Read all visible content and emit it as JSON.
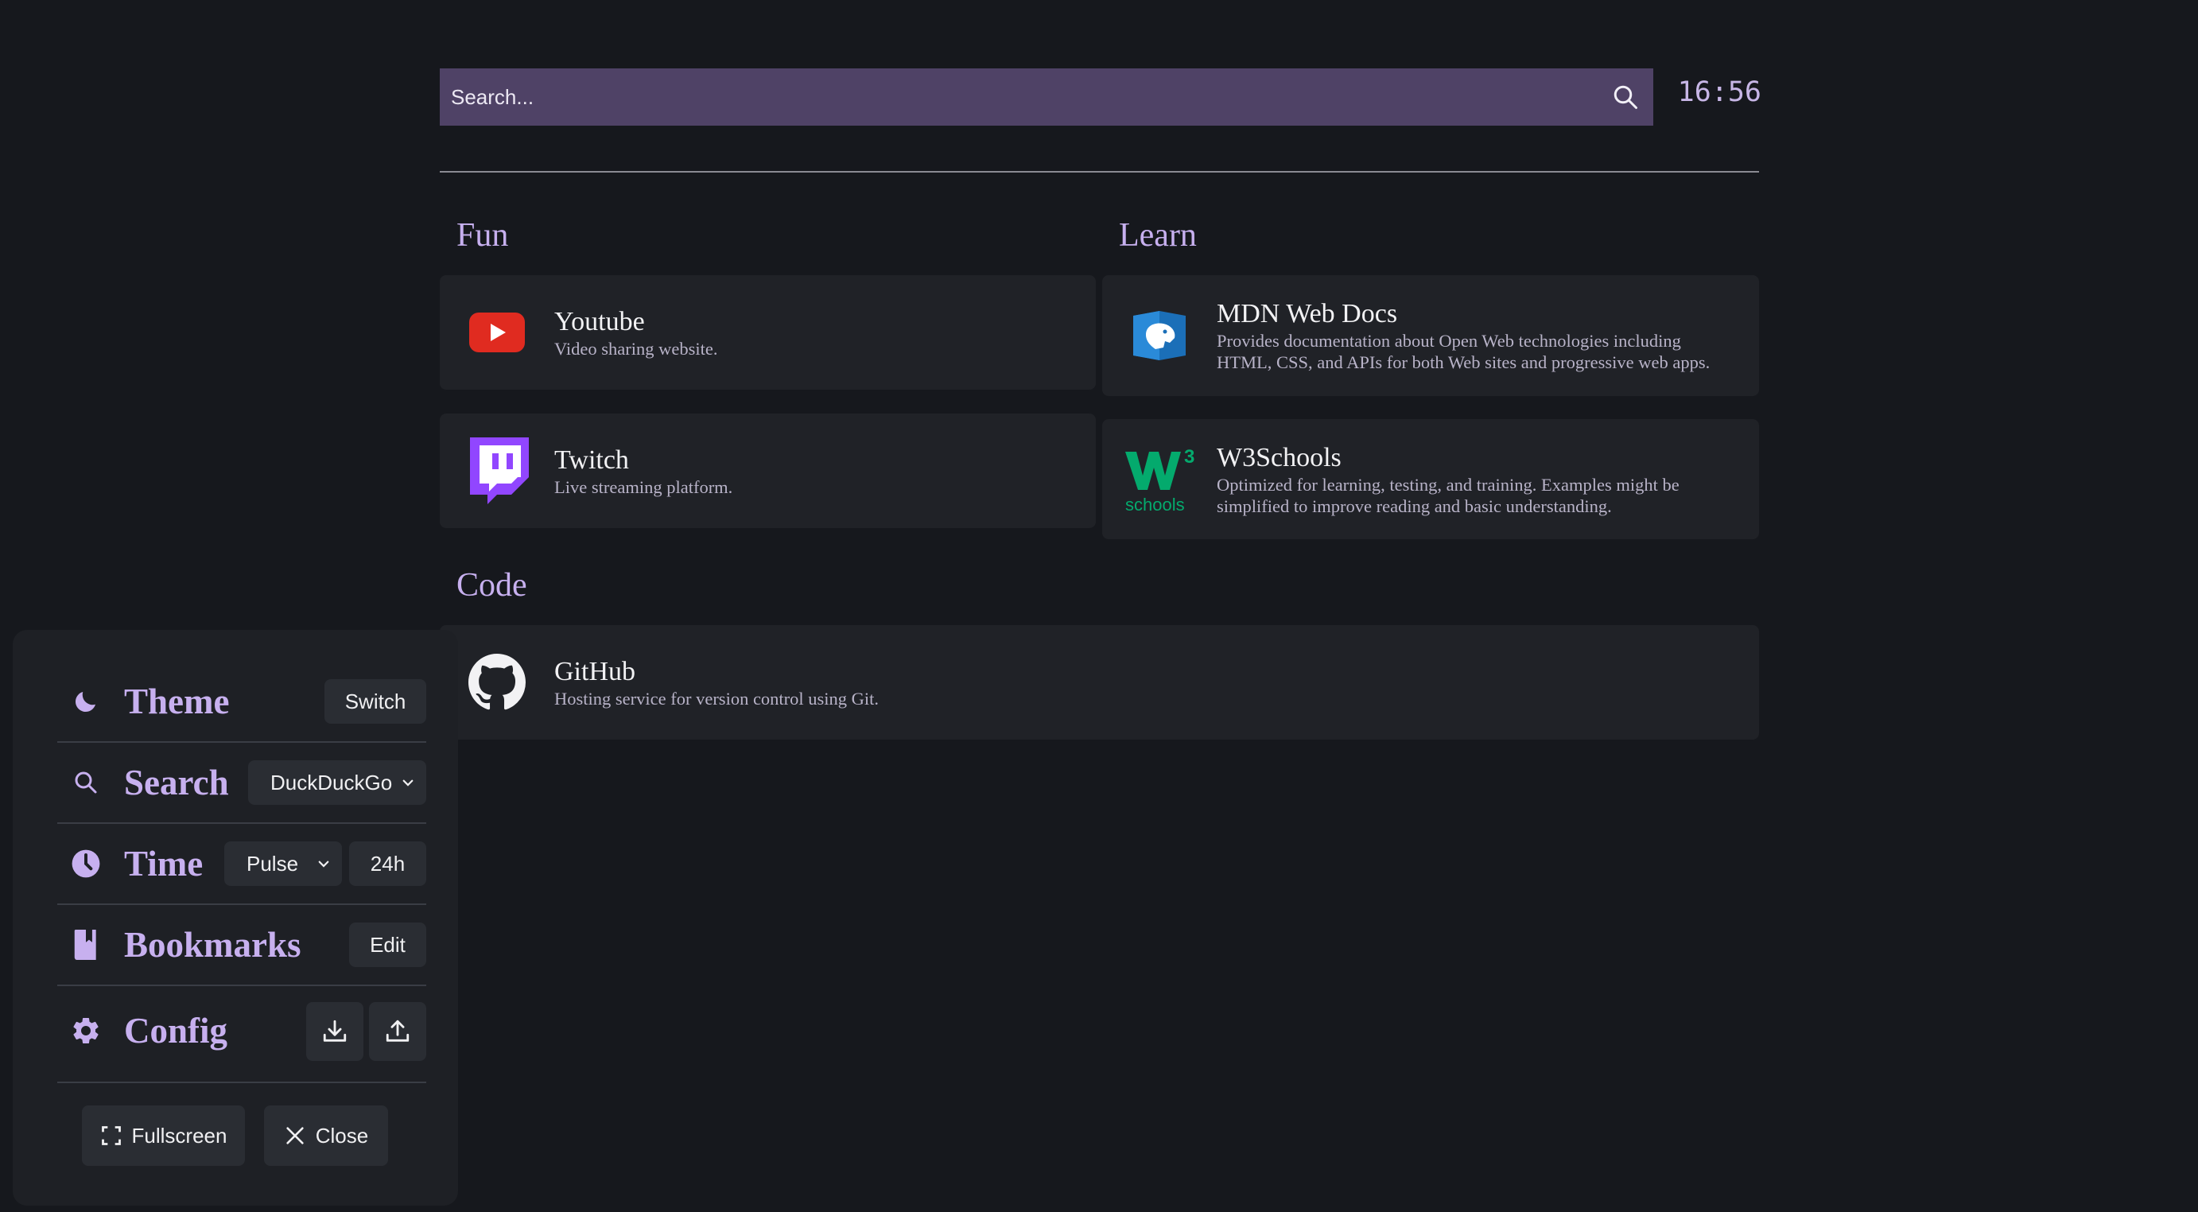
{
  "search": {
    "placeholder": "Search..."
  },
  "clock": {
    "time": "16:56"
  },
  "groups": [
    {
      "title": "Fun",
      "bookmarks": [
        {
          "title": "Youtube",
          "description": "Video sharing website.",
          "icon": "youtube-icon"
        },
        {
          "title": "Twitch",
          "description": "Live streaming platform.",
          "icon": "twitch-icon"
        }
      ]
    },
    {
      "title": "Learn",
      "bookmarks": [
        {
          "title": "MDN Web Docs",
          "description_lines": [
            "Provides documentation about Open Web technologies including",
            "HTML, CSS, and APIs for both Web sites and progressive web apps."
          ],
          "icon": "mdn-icon"
        },
        {
          "title": "W3Schools",
          "description_lines": [
            "Optimized for learning, testing, and training. Examples might be",
            "simplified to improve reading and basic understanding."
          ],
          "icon": "w3schools-icon"
        }
      ]
    },
    {
      "title": "Code",
      "bookmarks": [
        {
          "title": "GitHub",
          "description": "Hosting service for version control using Git.",
          "icon": "github-icon"
        }
      ]
    }
  ],
  "settings": {
    "theme": {
      "label": "Theme",
      "button": "Switch",
      "icon": "moon-icon"
    },
    "search": {
      "label": "Search",
      "engine": "DuckDuckGo",
      "icon": "search-icon"
    },
    "time": {
      "label": "Time",
      "style": "Pulse",
      "format": "24h",
      "icon": "clock-icon"
    },
    "bookmarks": {
      "label": "Bookmarks",
      "button": "Edit",
      "icon": "bookmark-icon"
    },
    "config": {
      "label": "Config",
      "icon": "gear-icon",
      "download_icon": "download-icon",
      "upload_icon": "upload-icon"
    },
    "fullscreen": {
      "label": "Fullscreen",
      "icon": "fullscreen-icon"
    },
    "close": {
      "label": "Close",
      "icon": "close-icon"
    }
  },
  "colors": {
    "background": "#16181d",
    "search_bar": "#4f4266",
    "accent": "#c7b0ef",
    "card": "#202227",
    "panel": "#1e2025"
  }
}
